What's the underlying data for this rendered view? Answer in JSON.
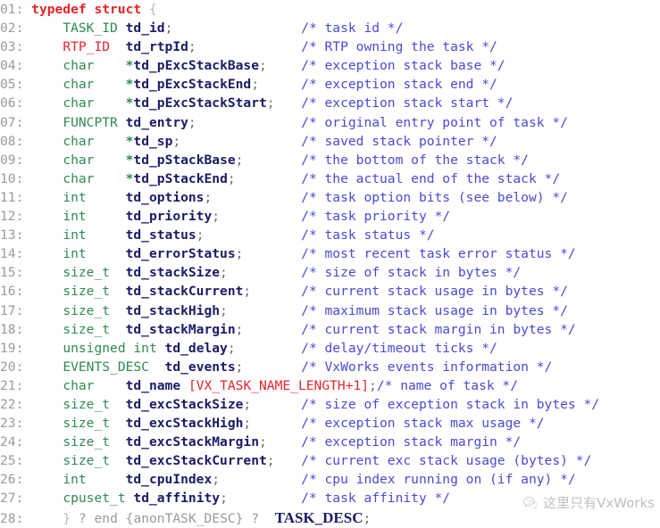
{
  "document": {
    "title": "VxWorks TASK_DESC structure listing",
    "language": "c",
    "line_count": 28,
    "background_color": "#ffffff",
    "colors": {
      "line_number": "#9a9a9a",
      "keyword": "#e8242c",
      "type": "#2f8a52",
      "identifier": "#1b1b66",
      "comment": "#4a4ad2",
      "macro": "#e8242c",
      "punctuation": "#6d6d6d",
      "watermark": "#8e8e8e"
    }
  },
  "lines": [
    {
      "num": "01:",
      "indent": "",
      "type": "",
      "gap1": "",
      "name": "typedef struct {",
      "decl_tail": "",
      "comment": ""
    },
    {
      "num": "02:",
      "indent": "    ",
      "type": "TASK_ID",
      "gap1": " ",
      "name": "td_id",
      "decl_tail": ";",
      "comment": "/* task id */"
    },
    {
      "num": "03:",
      "indent": "    ",
      "type": "RTP_ID",
      "gap1": "  ",
      "name": "td_rtpId",
      "decl_tail": ";",
      "comment": "/* RTP owning the task */"
    },
    {
      "num": "04:",
      "indent": "    ",
      "type": "char",
      "gap1": "    ",
      "name": "*td_pExcStackBase",
      "decl_tail": ";",
      "comment": "/* exception stack base */"
    },
    {
      "num": "05:",
      "indent": "    ",
      "type": "char",
      "gap1": "    ",
      "name": "*td_pExcStackEnd",
      "decl_tail": ";",
      "comment": "/* exception stack end */"
    },
    {
      "num": "06:",
      "indent": "    ",
      "type": "char",
      "gap1": "    ",
      "name": "*td_pExcStackStart",
      "decl_tail": ";",
      "comment": "/* exception stack start */"
    },
    {
      "num": "07:",
      "indent": "    ",
      "type": "FUNCPTR",
      "gap1": " ",
      "name": "td_entry",
      "decl_tail": ";",
      "comment": "/* original entry point of task */"
    },
    {
      "num": "08:",
      "indent": "    ",
      "type": "char",
      "gap1": "    ",
      "name": "*td_sp",
      "decl_tail": ";",
      "comment": "/* saved stack pointer */"
    },
    {
      "num": "09:",
      "indent": "    ",
      "type": "char",
      "gap1": "    ",
      "name": "*td_pStackBase",
      "decl_tail": ";",
      "comment": "/* the bottom of the stack */"
    },
    {
      "num": "10:",
      "indent": "    ",
      "type": "char",
      "gap1": "    ",
      "name": "*td_pStackEnd",
      "decl_tail": ";",
      "comment": "/* the actual end of the stack */"
    },
    {
      "num": "11:",
      "indent": "    ",
      "type": "int",
      "gap1": "     ",
      "name": "td_options",
      "decl_tail": ";",
      "comment": "/* task option bits (see below) */"
    },
    {
      "num": "12:",
      "indent": "    ",
      "type": "int",
      "gap1": "     ",
      "name": "td_priority",
      "decl_tail": ";",
      "comment": "/* task priority */"
    },
    {
      "num": "13:",
      "indent": "    ",
      "type": "int",
      "gap1": "     ",
      "name": "td_status",
      "decl_tail": ";",
      "comment": "/* task status */"
    },
    {
      "num": "14:",
      "indent": "    ",
      "type": "int",
      "gap1": "     ",
      "name": "td_errorStatus",
      "decl_tail": ";",
      "comment": "/* most recent task error status */"
    },
    {
      "num": "15:",
      "indent": "    ",
      "type": "size_t",
      "gap1": "  ",
      "name": "td_stackSize",
      "decl_tail": ";",
      "comment": "/* size of stack in bytes */"
    },
    {
      "num": "16:",
      "indent": "    ",
      "type": "size_t",
      "gap1": "  ",
      "name": "td_stackCurrent",
      "decl_tail": ";",
      "comment": "/* current stack usage in bytes */"
    },
    {
      "num": "17:",
      "indent": "    ",
      "type": "size_t",
      "gap1": "  ",
      "name": "td_stackHigh",
      "decl_tail": ";",
      "comment": "/* maximum stack usage in bytes */"
    },
    {
      "num": "18:",
      "indent": "    ",
      "type": "size_t",
      "gap1": "  ",
      "name": "td_stackMargin",
      "decl_tail": ";",
      "comment": "/* current stack margin in bytes */"
    },
    {
      "num": "19:",
      "indent": "    ",
      "type": "unsigned int",
      "gap1": " ",
      "name": "td_delay",
      "decl_tail": ";",
      "comment": "/* delay/timeout ticks */"
    },
    {
      "num": "20:",
      "indent": "    ",
      "type": "EVENTS_DESC",
      "gap1": "  ",
      "name": "td_events",
      "decl_tail": ";",
      "comment": "/* VxWorks events information */"
    },
    {
      "num": "21:",
      "indent": "    ",
      "type": "char",
      "gap1": "    ",
      "name": "td_name",
      "decl_tail": "",
      "array": "[VX_TASK_NAME_LENGTH+1]",
      "array_tail": ";",
      "comment": "/* name of task */"
    },
    {
      "num": "22:",
      "indent": "    ",
      "type": "size_t",
      "gap1": "  ",
      "name": "td_excStackSize",
      "decl_tail": ";",
      "comment": "/* size of exception stack in bytes */"
    },
    {
      "num": "23:",
      "indent": "    ",
      "type": "size_t",
      "gap1": "  ",
      "name": "td_excStackHigh",
      "decl_tail": ";",
      "comment": "/* exception stack max usage */"
    },
    {
      "num": "24:",
      "indent": "    ",
      "type": "size_t",
      "gap1": "  ",
      "name": "td_excStackMargin",
      "decl_tail": ";",
      "comment": "/* exception stack margin */"
    },
    {
      "num": "25:",
      "indent": "    ",
      "type": "size_t",
      "gap1": "  ",
      "name": "td_excStackCurrent",
      "decl_tail": ";",
      "comment": "/* current exc stack usage (bytes) */"
    },
    {
      "num": "26:",
      "indent": "    ",
      "type": "int",
      "gap1": "     ",
      "name": "td_cpuIndex",
      "decl_tail": ";",
      "comment": "/* cpu index running on (if any) */"
    },
    {
      "num": "27:",
      "indent": "    ",
      "type": "cpuset_t",
      "gap1": " ",
      "name": "td_affinity",
      "decl_tail": ";",
      "comment": "/* task affinity */"
    }
  ],
  "closing_line": {
    "num": "28:",
    "indent": "    ",
    "brace": "}",
    "anon_marker_left": "?",
    "anon_word": "end",
    "anon_name": "{anonTASK_DESC}",
    "anon_marker_right": "?",
    "typedef_name": "TASK_DESC",
    "terminator": ";"
  },
  "watermark": {
    "icon": "wechat-logo-icon",
    "text": "这里只有VxWorks"
  }
}
